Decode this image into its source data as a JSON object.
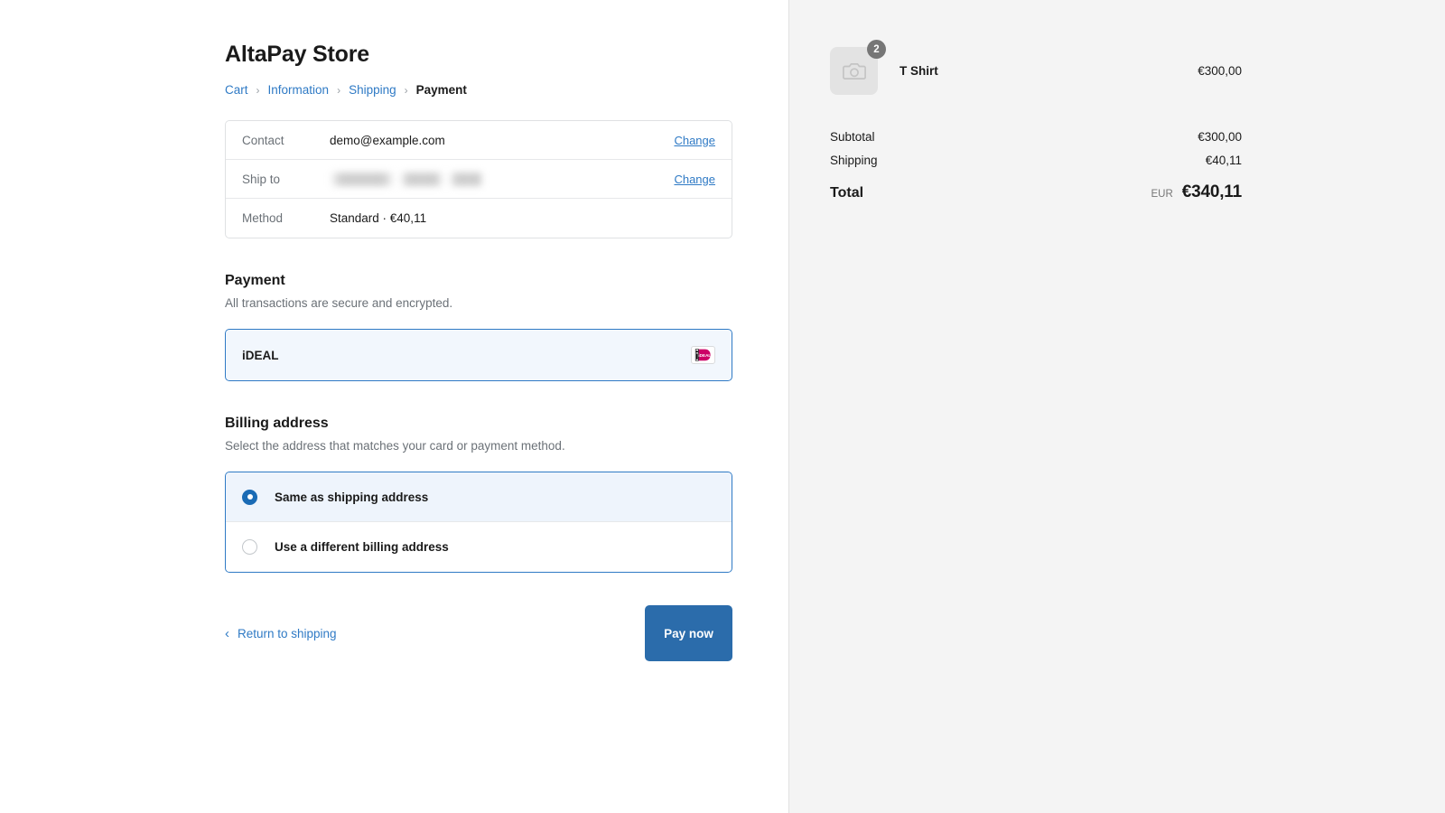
{
  "store": {
    "title": "AltaPay Store"
  },
  "breadcrumb": {
    "items": [
      {
        "label": "Cart",
        "current": false
      },
      {
        "label": "Information",
        "current": false
      },
      {
        "label": "Shipping",
        "current": false
      },
      {
        "label": "Payment",
        "current": true
      }
    ],
    "separator": "›"
  },
  "review": {
    "rows": [
      {
        "label": "Contact",
        "value": "demo@example.com",
        "redacted": false,
        "action": "Change"
      },
      {
        "label": "Ship to",
        "value": "",
        "redacted": true,
        "action": "Change"
      },
      {
        "label": "Method",
        "value": "Standard · €40,11",
        "redacted": false,
        "action": ""
      }
    ]
  },
  "payment": {
    "heading": "Payment",
    "subtext": "All transactions are secure and encrypted.",
    "methods": [
      {
        "label": "iDEAL",
        "selected": true,
        "badge_text": "iDEAL",
        "badge_icon": "ideal-logo-icon"
      }
    ]
  },
  "billing": {
    "heading": "Billing address",
    "subtext": "Select the address that matches your card or payment method.",
    "options": [
      {
        "label": "Same as shipping address",
        "selected": true
      },
      {
        "label": "Use a different billing address",
        "selected": false
      }
    ]
  },
  "actions": {
    "back_label": "Return to shipping",
    "back_icon": "chevron-left-icon",
    "pay_label": "Pay now"
  },
  "summary": {
    "items": [
      {
        "name": "T Shirt",
        "price": "€300,00",
        "quantity": "2",
        "thumb_icon": "camera-placeholder-icon"
      }
    ],
    "totals": [
      {
        "label": "Subtotal",
        "value": "€300,00"
      },
      {
        "label": "Shipping",
        "value": "€40,11"
      }
    ],
    "grand_total": {
      "label": "Total",
      "currency": "EUR",
      "value": "€340,11"
    }
  },
  "colors": {
    "link": "#2f7ac5",
    "accent": "#2b6cab",
    "radio_selected": "#1a6bb5",
    "summary_bg": "#f4f4f4",
    "ideal_magenta": "#cc0066"
  }
}
